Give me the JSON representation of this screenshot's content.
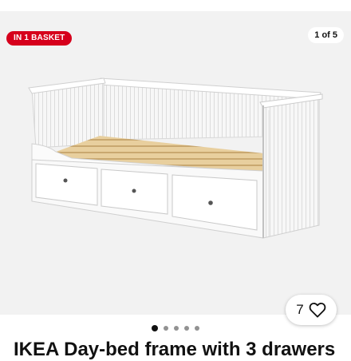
{
  "image": {
    "badge_label": "IN 1 BASKET",
    "counter_label": "1 of 5",
    "total_images": 5,
    "active_index": 0
  },
  "favourite": {
    "count": "7",
    "icon": "heart-outline-icon"
  },
  "product": {
    "title": "IKEA Day-bed frame with 3 drawers"
  },
  "colors": {
    "badge_bg": "#d6001c",
    "image_bg": "#f2f2f2",
    "dot_active": "#111111",
    "dot_inactive": "#929292"
  }
}
